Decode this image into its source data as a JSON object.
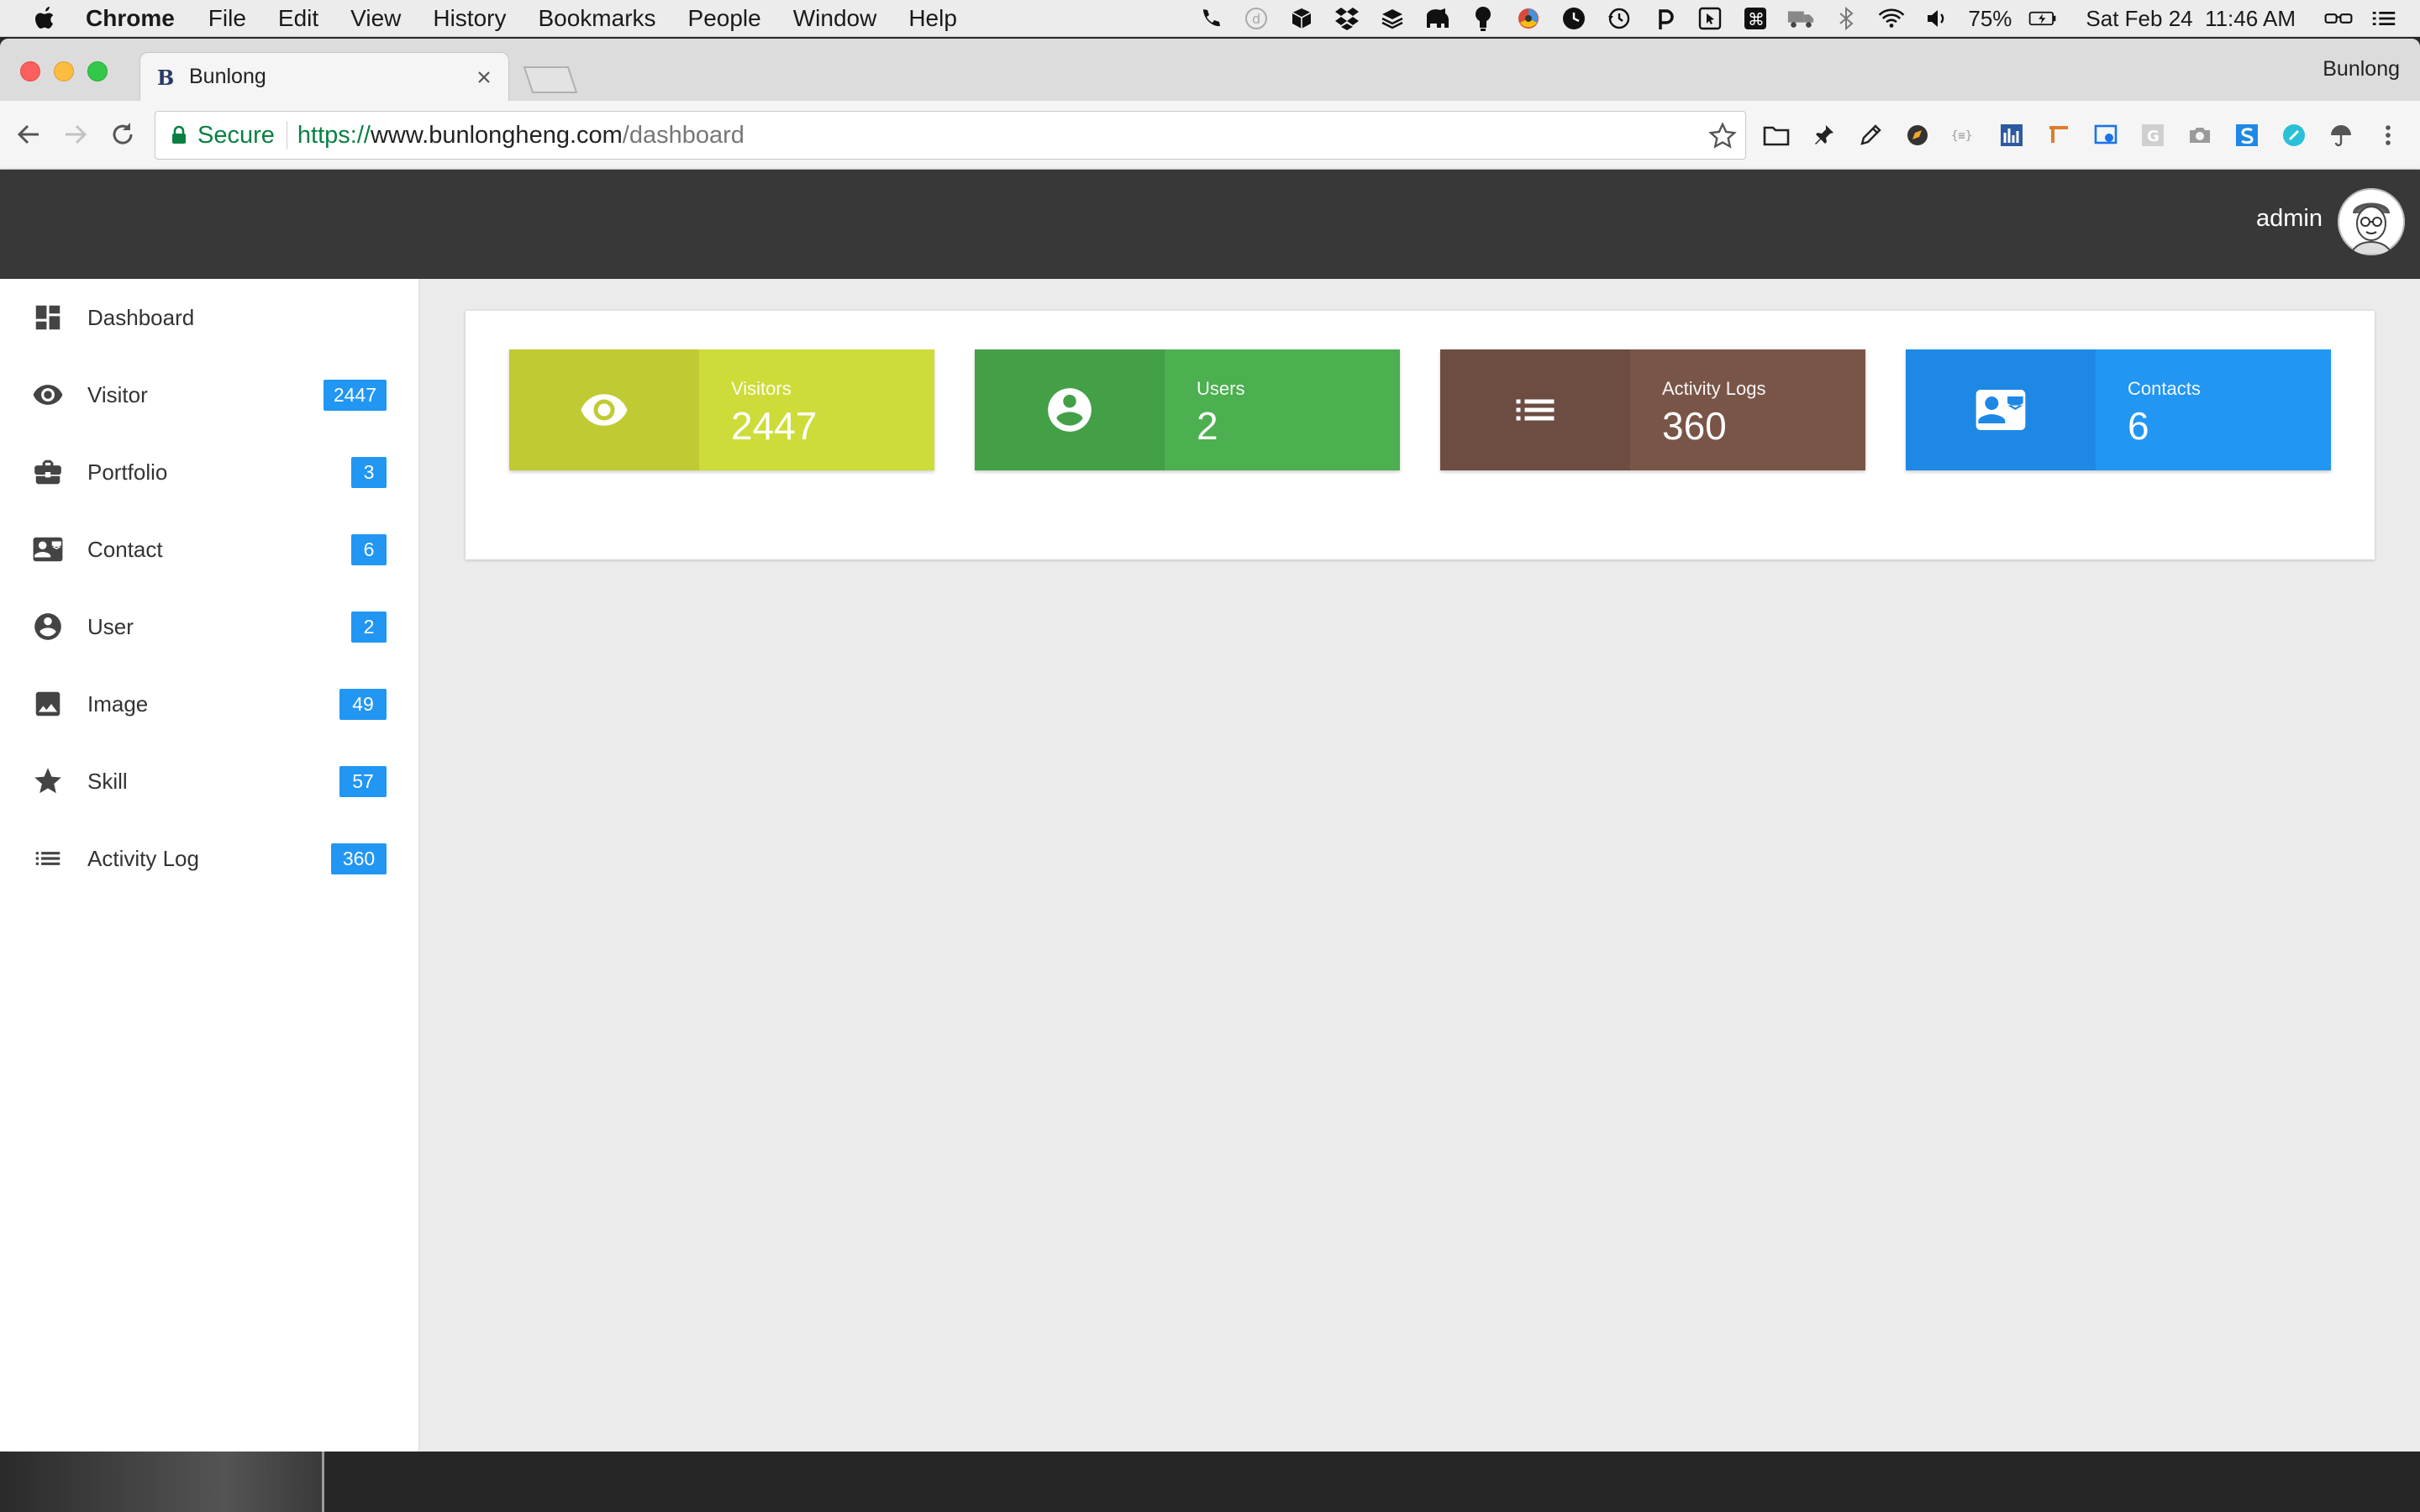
{
  "menubar": {
    "app": "Chrome",
    "items": [
      "File",
      "Edit",
      "View",
      "History",
      "Bookmarks",
      "People",
      "Window",
      "Help"
    ],
    "battery": "75%",
    "clock": "Sat Feb 24  11:46 AM"
  },
  "browser": {
    "tab_title": "Bunlong",
    "profile": "Bunlong",
    "secure_label": "Secure",
    "url": {
      "scheme": "https://",
      "host": "www.bunlongheng.com",
      "path": "/dashboard"
    }
  },
  "header": {
    "username": "admin"
  },
  "sidebar": {
    "items": [
      {
        "label": "Dashboard",
        "icon": "dashboard-icon",
        "badge": ""
      },
      {
        "label": "Visitor",
        "icon": "eye-icon",
        "badge": "2447"
      },
      {
        "label": "Portfolio",
        "icon": "briefcase-icon",
        "badge": "3"
      },
      {
        "label": "Contact",
        "icon": "contact-card-icon",
        "badge": "6"
      },
      {
        "label": "User",
        "icon": "account-circle-icon",
        "badge": "2"
      },
      {
        "label": "Image",
        "icon": "image-icon",
        "badge": "49"
      },
      {
        "label": "Skill",
        "icon": "star-icon",
        "badge": "57"
      },
      {
        "label": "Activity Log",
        "icon": "list-icon",
        "badge": "360"
      }
    ]
  },
  "stats": [
    {
      "title": "Visitors",
      "value": "2447",
      "icon": "eye-icon",
      "color_dark": "#c0ca33",
      "color_light": "#cddc39"
    },
    {
      "title": "Users",
      "value": "2",
      "icon": "account-circle-icon",
      "color_dark": "#43a047",
      "color_light": "#4caf50"
    },
    {
      "title": "Activity Logs",
      "value": "360",
      "icon": "list-icon",
      "color_dark": "#6d4c41",
      "color_light": "#795548"
    },
    {
      "title": "Contacts",
      "value": "6",
      "icon": "contact-card-icon",
      "color_dark": "#1e88e5",
      "color_light": "#2196f3"
    }
  ],
  "colors": {
    "header": "#383838",
    "badge": "#2196f3",
    "secure": "#0b8043"
  }
}
